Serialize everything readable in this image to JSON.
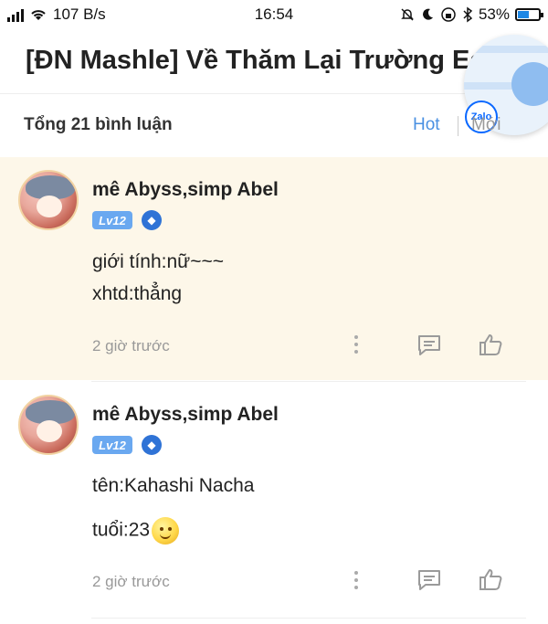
{
  "status_bar": {
    "network_speed": "107 B/s",
    "time": "16:54",
    "battery": "53%",
    "battery_level": 0.53
  },
  "header": {
    "title": "[ĐN Mashle] Về Thăm Lại Trường Ea"
  },
  "zalo": {
    "logo_label": "Zalo"
  },
  "comments_bar": {
    "total_label": "Tổng 21 bình luận",
    "sort_hot": "Hot",
    "sort_new": "Mới"
  },
  "comments": [
    {
      "username": "mê Abyss,simp Abel",
      "level": "Lv12",
      "lines": [
        "giới tính:nữ~~~",
        "xhtd:thẳng"
      ],
      "time": "2 giờ trước"
    },
    {
      "username": "mê Abyss,simp Abel",
      "level": "Lv12",
      "lines": [
        "tên:Kahashi Nacha",
        "tuổi:23"
      ],
      "time": "2 giờ trước"
    }
  ],
  "icons": {
    "wifi": "wifi-icon",
    "mute": "bell-off-icon",
    "moon": "moon-icon",
    "bluetooth": "bluetooth-icon",
    "more": "more-vertical-icon",
    "reply": "comment-icon",
    "like": "thumb-up-icon",
    "smile": "smile-emoji-icon"
  },
  "colors": {
    "highlight_bg": "#fdf7e9",
    "accent_blue": "#4a90e2",
    "level_badge": "#6aa8f0"
  }
}
